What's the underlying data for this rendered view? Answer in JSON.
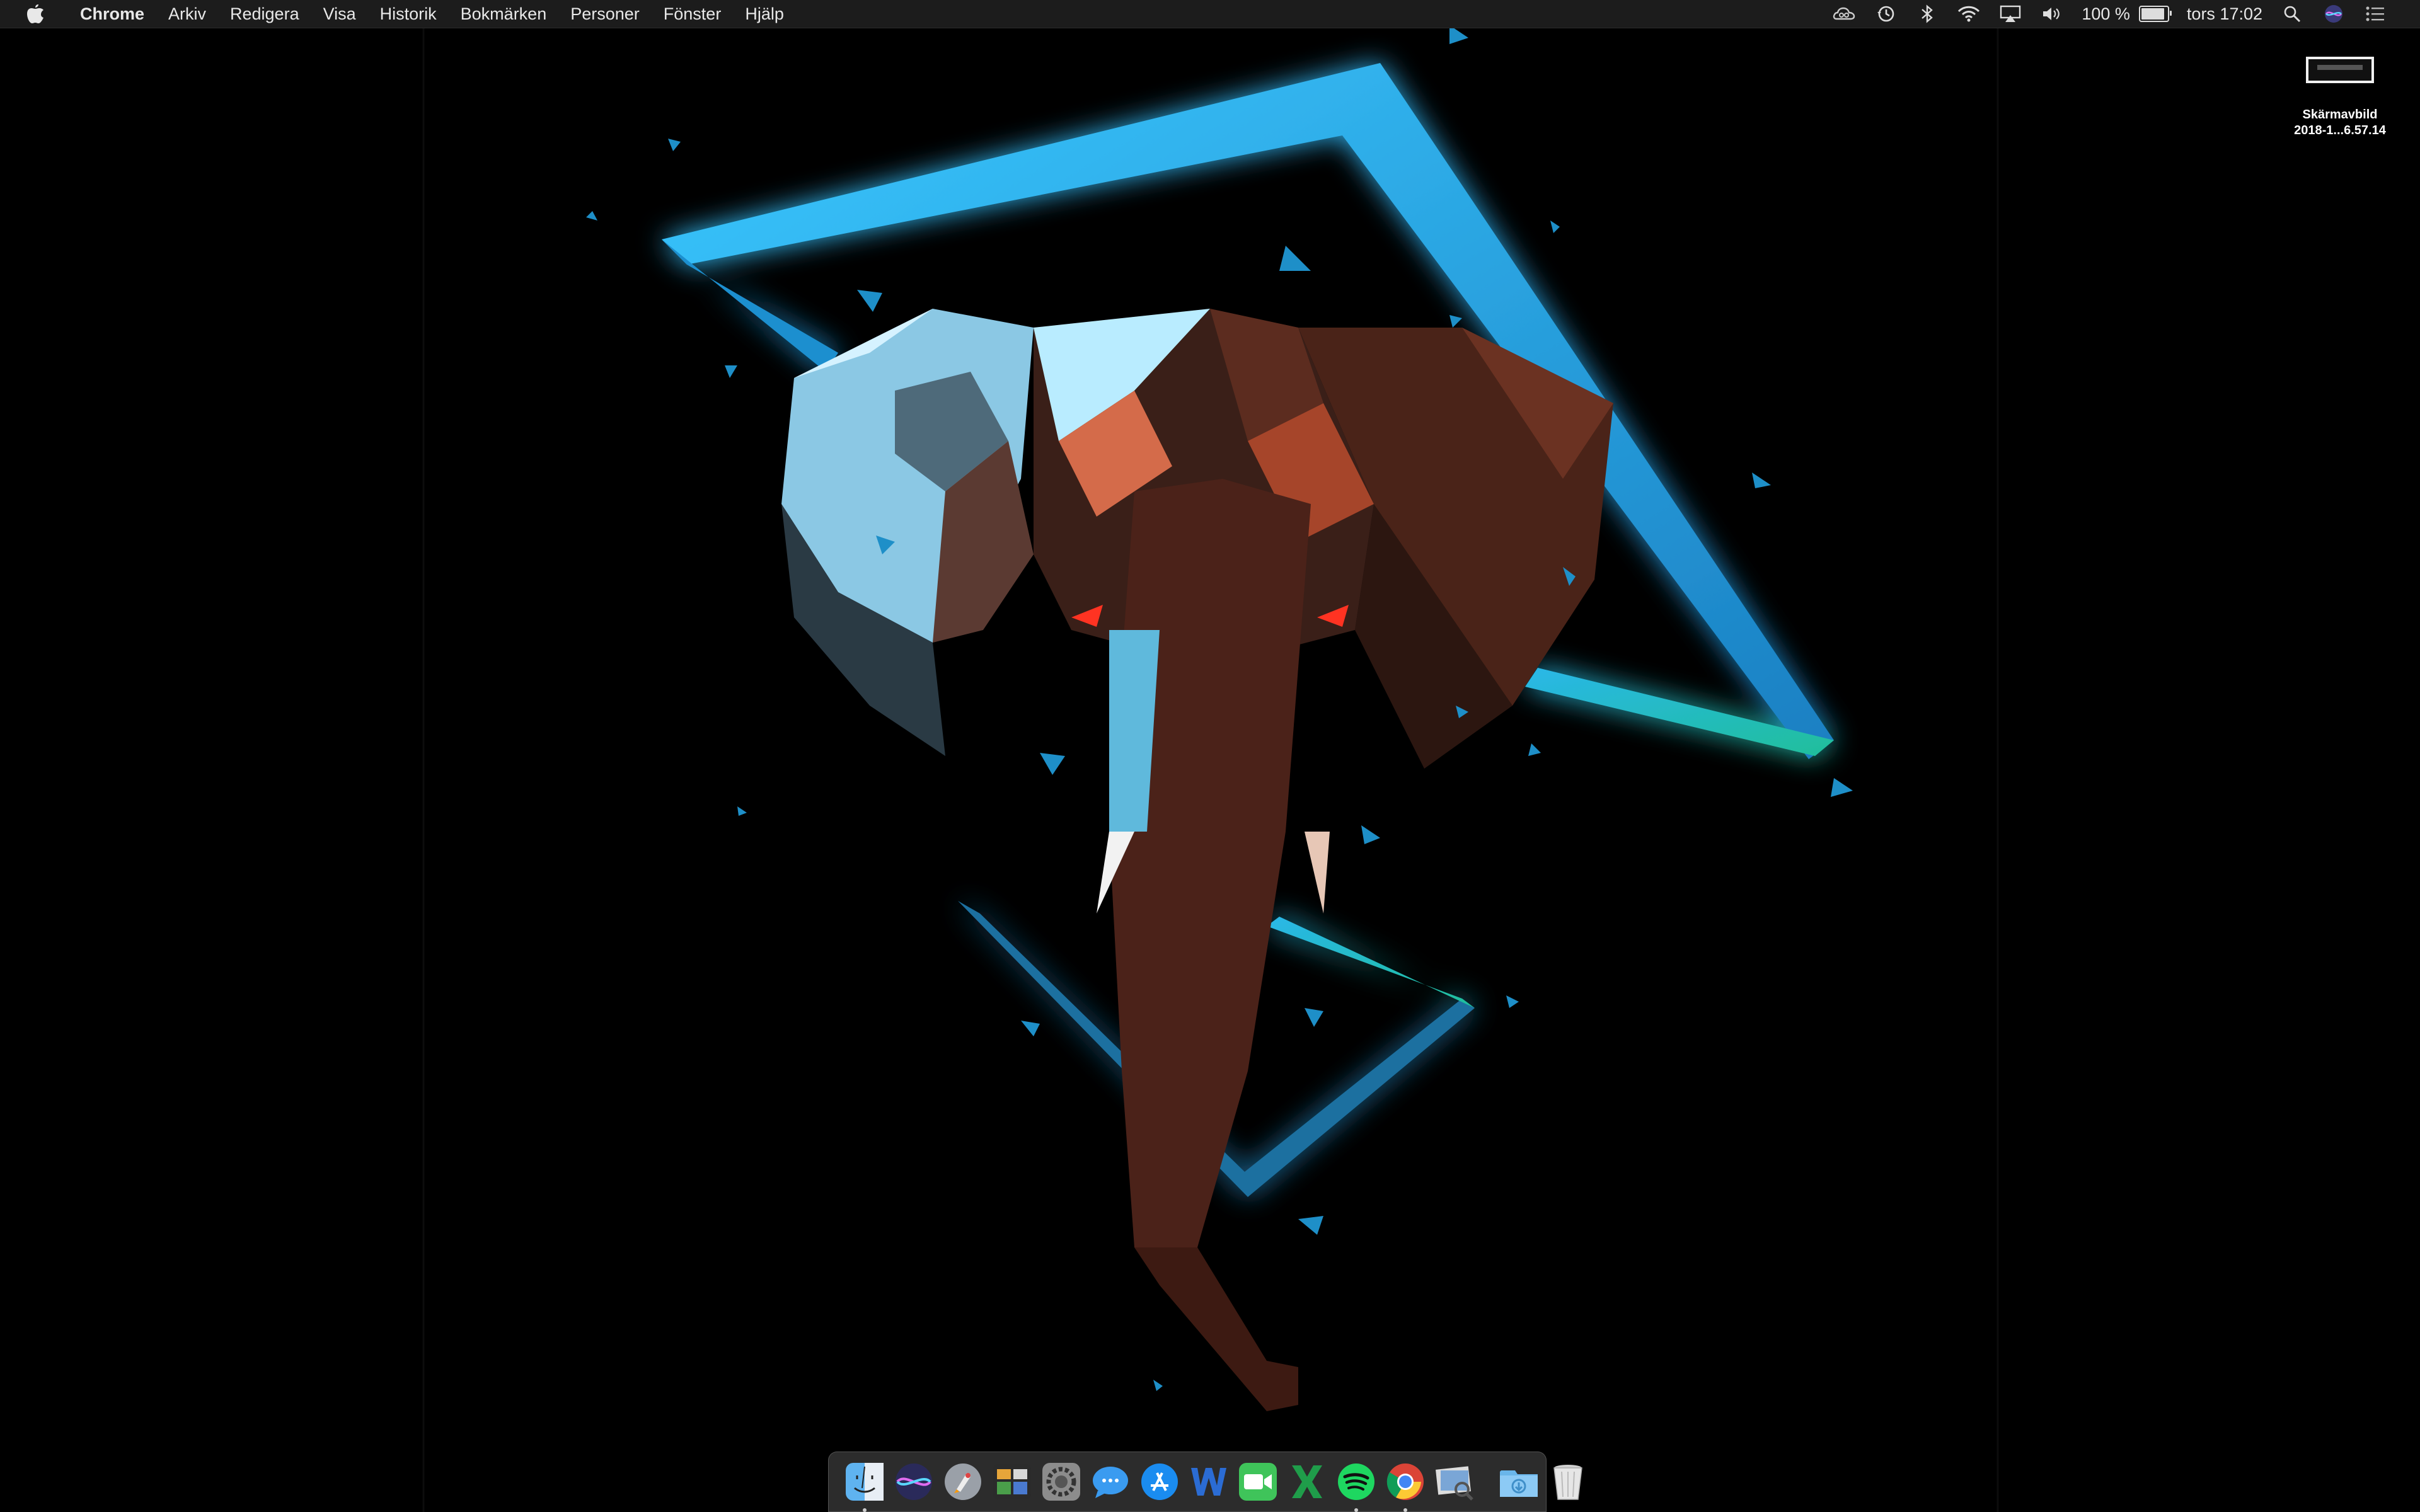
{
  "menubar": {
    "app_name": "Chrome",
    "menus": [
      "Arkiv",
      "Redigera",
      "Visa",
      "Historik",
      "Bokmärken",
      "Personer",
      "Fönster",
      "Hjälp"
    ],
    "battery_text": "100 %",
    "battery_level": 1.0,
    "clock": "tors 17:02",
    "status_icons": [
      "creative-cloud-icon",
      "time-machine-icon",
      "bluetooth-icon",
      "wifi-icon",
      "airplay-icon",
      "volume-icon",
      "battery-icon",
      "spotlight-icon",
      "siri-icon",
      "notification-center-icon"
    ]
  },
  "desktop": {
    "file_label_line1": "Skärmavbild",
    "file_label_line2": "2018-1...6.57.14"
  },
  "dock": {
    "apps": [
      {
        "name": "finder-icon",
        "running": true
      },
      {
        "name": "siri-icon",
        "running": false
      },
      {
        "name": "launchpad-icon",
        "running": false
      },
      {
        "name": "mission-control-icon",
        "running": false
      },
      {
        "name": "system-preferences-icon",
        "running": false
      },
      {
        "name": "messages-icon",
        "running": false
      },
      {
        "name": "app-store-icon",
        "running": false
      },
      {
        "name": "word-icon",
        "running": false
      },
      {
        "name": "facetime-icon",
        "running": false
      },
      {
        "name": "excel-icon",
        "running": false
      },
      {
        "name": "spotify-icon",
        "running": true
      },
      {
        "name": "chrome-icon",
        "running": true
      },
      {
        "name": "preview-icon",
        "running": false
      }
    ],
    "stack_icons": [
      "downloads-folder-icon",
      "trash-icon"
    ]
  },
  "colors": {
    "menubar_bg": "#1c1c1c",
    "desktop_bg": "#000000",
    "neon_blue": "#29b6f6",
    "elephant_left": "#8fd3ec",
    "elephant_right": "#5a2a1c"
  }
}
